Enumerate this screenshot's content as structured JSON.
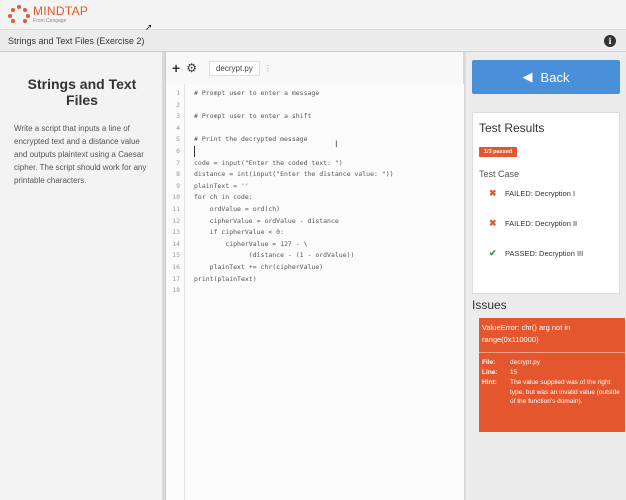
{
  "brand": {
    "title": "MINDTAP",
    "subtitle": "From Cengage",
    "color": "#e4572e"
  },
  "breadcrumb": "Strings and Text Files (Exercise 2)",
  "info_icon": "i",
  "instructions": {
    "title": "Strings and Text Files",
    "body": "Write a script that inputs a line of encrypted text and a distance value and outputs plaintext using a Caesar cipher. The script should work for any printable characters."
  },
  "editor": {
    "add_label": "+",
    "gear_label": "⚙",
    "file_tab": "decrypt.py",
    "tab_menu": "⋮",
    "lines": [
      {
        "n": "1",
        "text": "# Prompt user to enter a message"
      },
      {
        "n": "2",
        "text": ""
      },
      {
        "n": "3",
        "text": "# Prompt user to enter a shift"
      },
      {
        "n": "4",
        "text": ""
      },
      {
        "n": "5",
        "text": "# Print the decrypted message"
      },
      {
        "n": "6",
        "text": ""
      },
      {
        "n": "7",
        "text": "code = input(\"Enter the coded text: \")"
      },
      {
        "n": "8",
        "text": "distance = int(input(\"Enter the distance value: \"))"
      },
      {
        "n": "9",
        "text": "plainText = ''"
      },
      {
        "n": "10",
        "text": "for ch in code:"
      },
      {
        "n": "11",
        "text": "    ordValue = ord(ch)"
      },
      {
        "n": "12",
        "text": "    cipherValue = ordValue - distance"
      },
      {
        "n": "13",
        "text": "    if cipherValue < 0:"
      },
      {
        "n": "14",
        "text": "        cipherValue = 127 - \\"
      },
      {
        "n": "15",
        "text": "              (distance - (1 - ordValue))"
      },
      {
        "n": "16",
        "text": "    plainText += chr(cipherValue)"
      },
      {
        "n": "17",
        "text": "print(plainText)"
      },
      {
        "n": "18",
        "text": ""
      }
    ]
  },
  "right": {
    "back_label": "Back",
    "back_color": "#4a90d9",
    "results_title": "Test Results",
    "passed_badge": "1/3 passed",
    "test_case_header": "Test Case",
    "test_cases": [
      {
        "icon": "✖",
        "status": "fail",
        "label": "FAILED: Decryption I"
      },
      {
        "icon": "✖",
        "status": "fail",
        "label": "FAILED: Decryption II"
      },
      {
        "icon": "✔",
        "status": "pass",
        "label": "PASSED: Decryption III"
      }
    ],
    "issues_title": "Issues",
    "issue": {
      "message": "ValueError: chr() arg not in range(0x110000)",
      "file_key": "File:",
      "file_val": "decrypt.py",
      "line_key": "Line:",
      "line_val": "15",
      "hint_key": "Hint:",
      "hint_val": "The value supplied was of the right type, but was an invalid value (outside of the function's domain)."
    }
  }
}
